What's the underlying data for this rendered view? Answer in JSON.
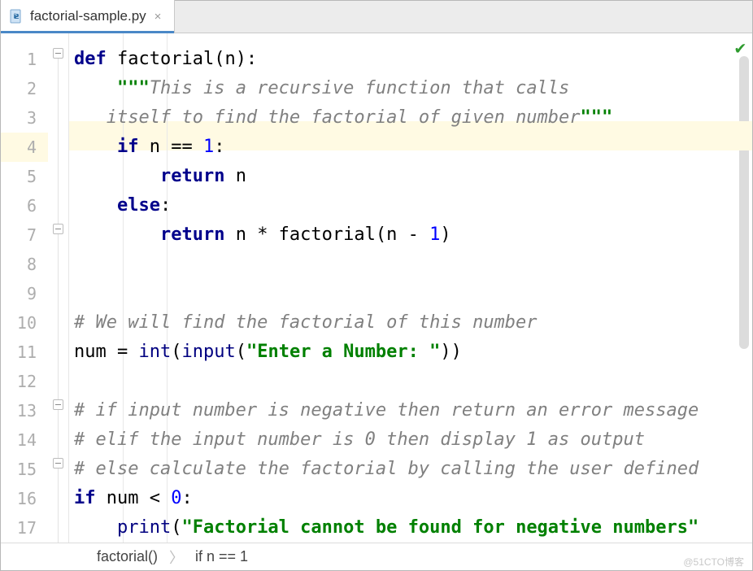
{
  "tab": {
    "filename": "factorial-sample.py",
    "close": "×"
  },
  "lines": [
    "1",
    "2",
    "3",
    "4",
    "5",
    "6",
    "7",
    "8",
    "9",
    "10",
    "11",
    "12",
    "13",
    "14",
    "15",
    "16",
    "17"
  ],
  "highlight_line": 4,
  "code": {
    "l1": {
      "def": "def",
      "name": " factorial(n):"
    },
    "l2": {
      "q": "\"\"\"",
      "t": "This is a recursive function that calls"
    },
    "l3": {
      "t": "itself to find the factorial of given number",
      "q": "\"\"\""
    },
    "l4": {
      "if": "if",
      "cond": " n == ",
      "one": "1",
      "colon": ":"
    },
    "l5": {
      "ret": "return",
      "n": " n"
    },
    "l6": {
      "else": "else",
      "colon": ":"
    },
    "l7": {
      "ret": "return",
      "expr1": " n * factorial(n - ",
      "one": "1",
      "expr2": ")"
    },
    "l10": {
      "c": "# We will find the factorial of this number"
    },
    "l11": {
      "a": "num = ",
      "int": "int",
      "p1": "(",
      "input": "input",
      "p2": "(",
      "s": "\"Enter a Number: \"",
      "p3": "))"
    },
    "l13": {
      "c": "# if input number is negative then return an error message"
    },
    "l14": {
      "c": "# elif the input number is 0 then display 1 as output"
    },
    "l15": {
      "c": "# else calculate the factorial by calling the user defined"
    },
    "l16": {
      "if": "if",
      "cond": " num < ",
      "zero": "0",
      "colon": ":"
    },
    "l17": {
      "pr": "print",
      "p1": "(",
      "s": "\"Factorial cannot be found for negative numbers\""
    }
  },
  "breadcrumb": {
    "a": "factorial()",
    "sep": "〉",
    "b": "if n == 1"
  },
  "watermark": "@51CTO博客",
  "colors": {
    "tab_underline": "#4a88c7",
    "highlight": "#fffae3"
  }
}
